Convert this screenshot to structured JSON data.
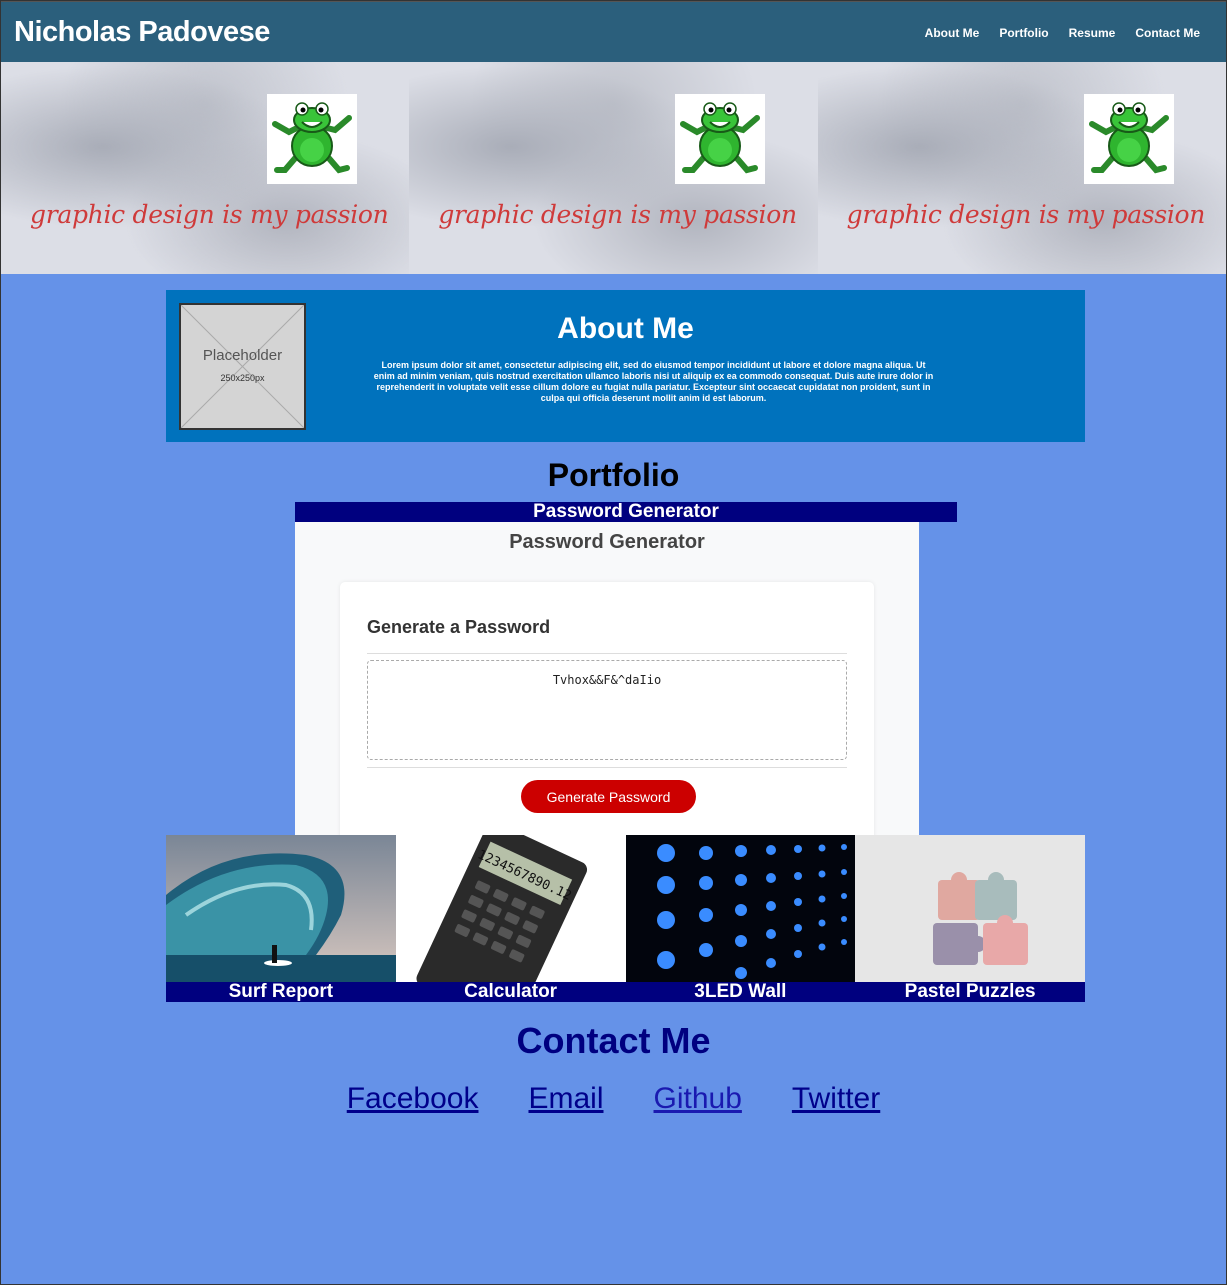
{
  "header": {
    "title": "Nicholas Padovese",
    "nav": [
      "About Me",
      "Portfolio",
      "Resume",
      "Contact Me"
    ]
  },
  "banner": {
    "caption": "graphic design is my passion",
    "tiles": 3
  },
  "about": {
    "placeholder_title": "Placeholder",
    "placeholder_size": "250x250px",
    "title": "About Me",
    "text": "Lorem ipsum dolor sit amet, consectetur adipiscing elit, sed do eiusmod tempor incididunt ut labore et dolore magna aliqua. Ut enim ad minim veniam, quis nostrud exercitation ullamco laboris nisi ut aliquip ex ea commodo consequat. Duis aute irure dolor in reprehenderit in voluptate velit esse cillum dolore eu fugiat nulla pariatur. Excepteur sint occaecat cupidatat non proident, sunt in culpa qui officia deserunt mollit anim id est laborum."
  },
  "portfolio": {
    "title": "Portfolio",
    "featured": {
      "label": "Password Generator",
      "app_heading": "Password Generator",
      "card_title": "Generate a Password",
      "password": "Tvhox&&F&^daIio",
      "button": "Generate Password"
    },
    "projects": [
      "Surf Report",
      "Calculator",
      "3LED Wall",
      "Pastel Puzzles"
    ]
  },
  "contact": {
    "title": "Contact Me",
    "links": [
      "Facebook",
      "Email",
      "Github",
      "Twitter"
    ]
  },
  "colors": {
    "background": "#6592e8",
    "header": "#2b5f7c",
    "about_bg": "#0072bd",
    "label_bar": "#00007f",
    "button": "#cc0000"
  }
}
